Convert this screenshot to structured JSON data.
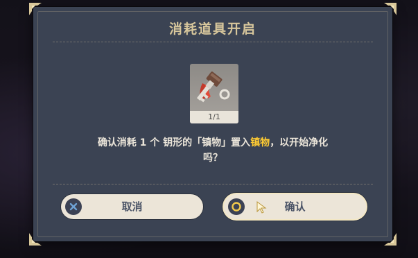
{
  "dialog": {
    "title": "消耗道具开启",
    "item": {
      "count_text": "1/1",
      "icon": "key-icon"
    },
    "message": {
      "part1": "确认消耗 1 个 钥形的「镇物」置入",
      "highlight": "镇物",
      "part2": "，以开始净化",
      "part3": "吗？"
    },
    "buttons": {
      "cancel_label": "取消",
      "confirm_label": "确认"
    }
  },
  "colors": {
    "title": "#d8c79c",
    "highlight": "#ffcc33",
    "panel": "#3b4353",
    "button": "#ece5d8"
  }
}
